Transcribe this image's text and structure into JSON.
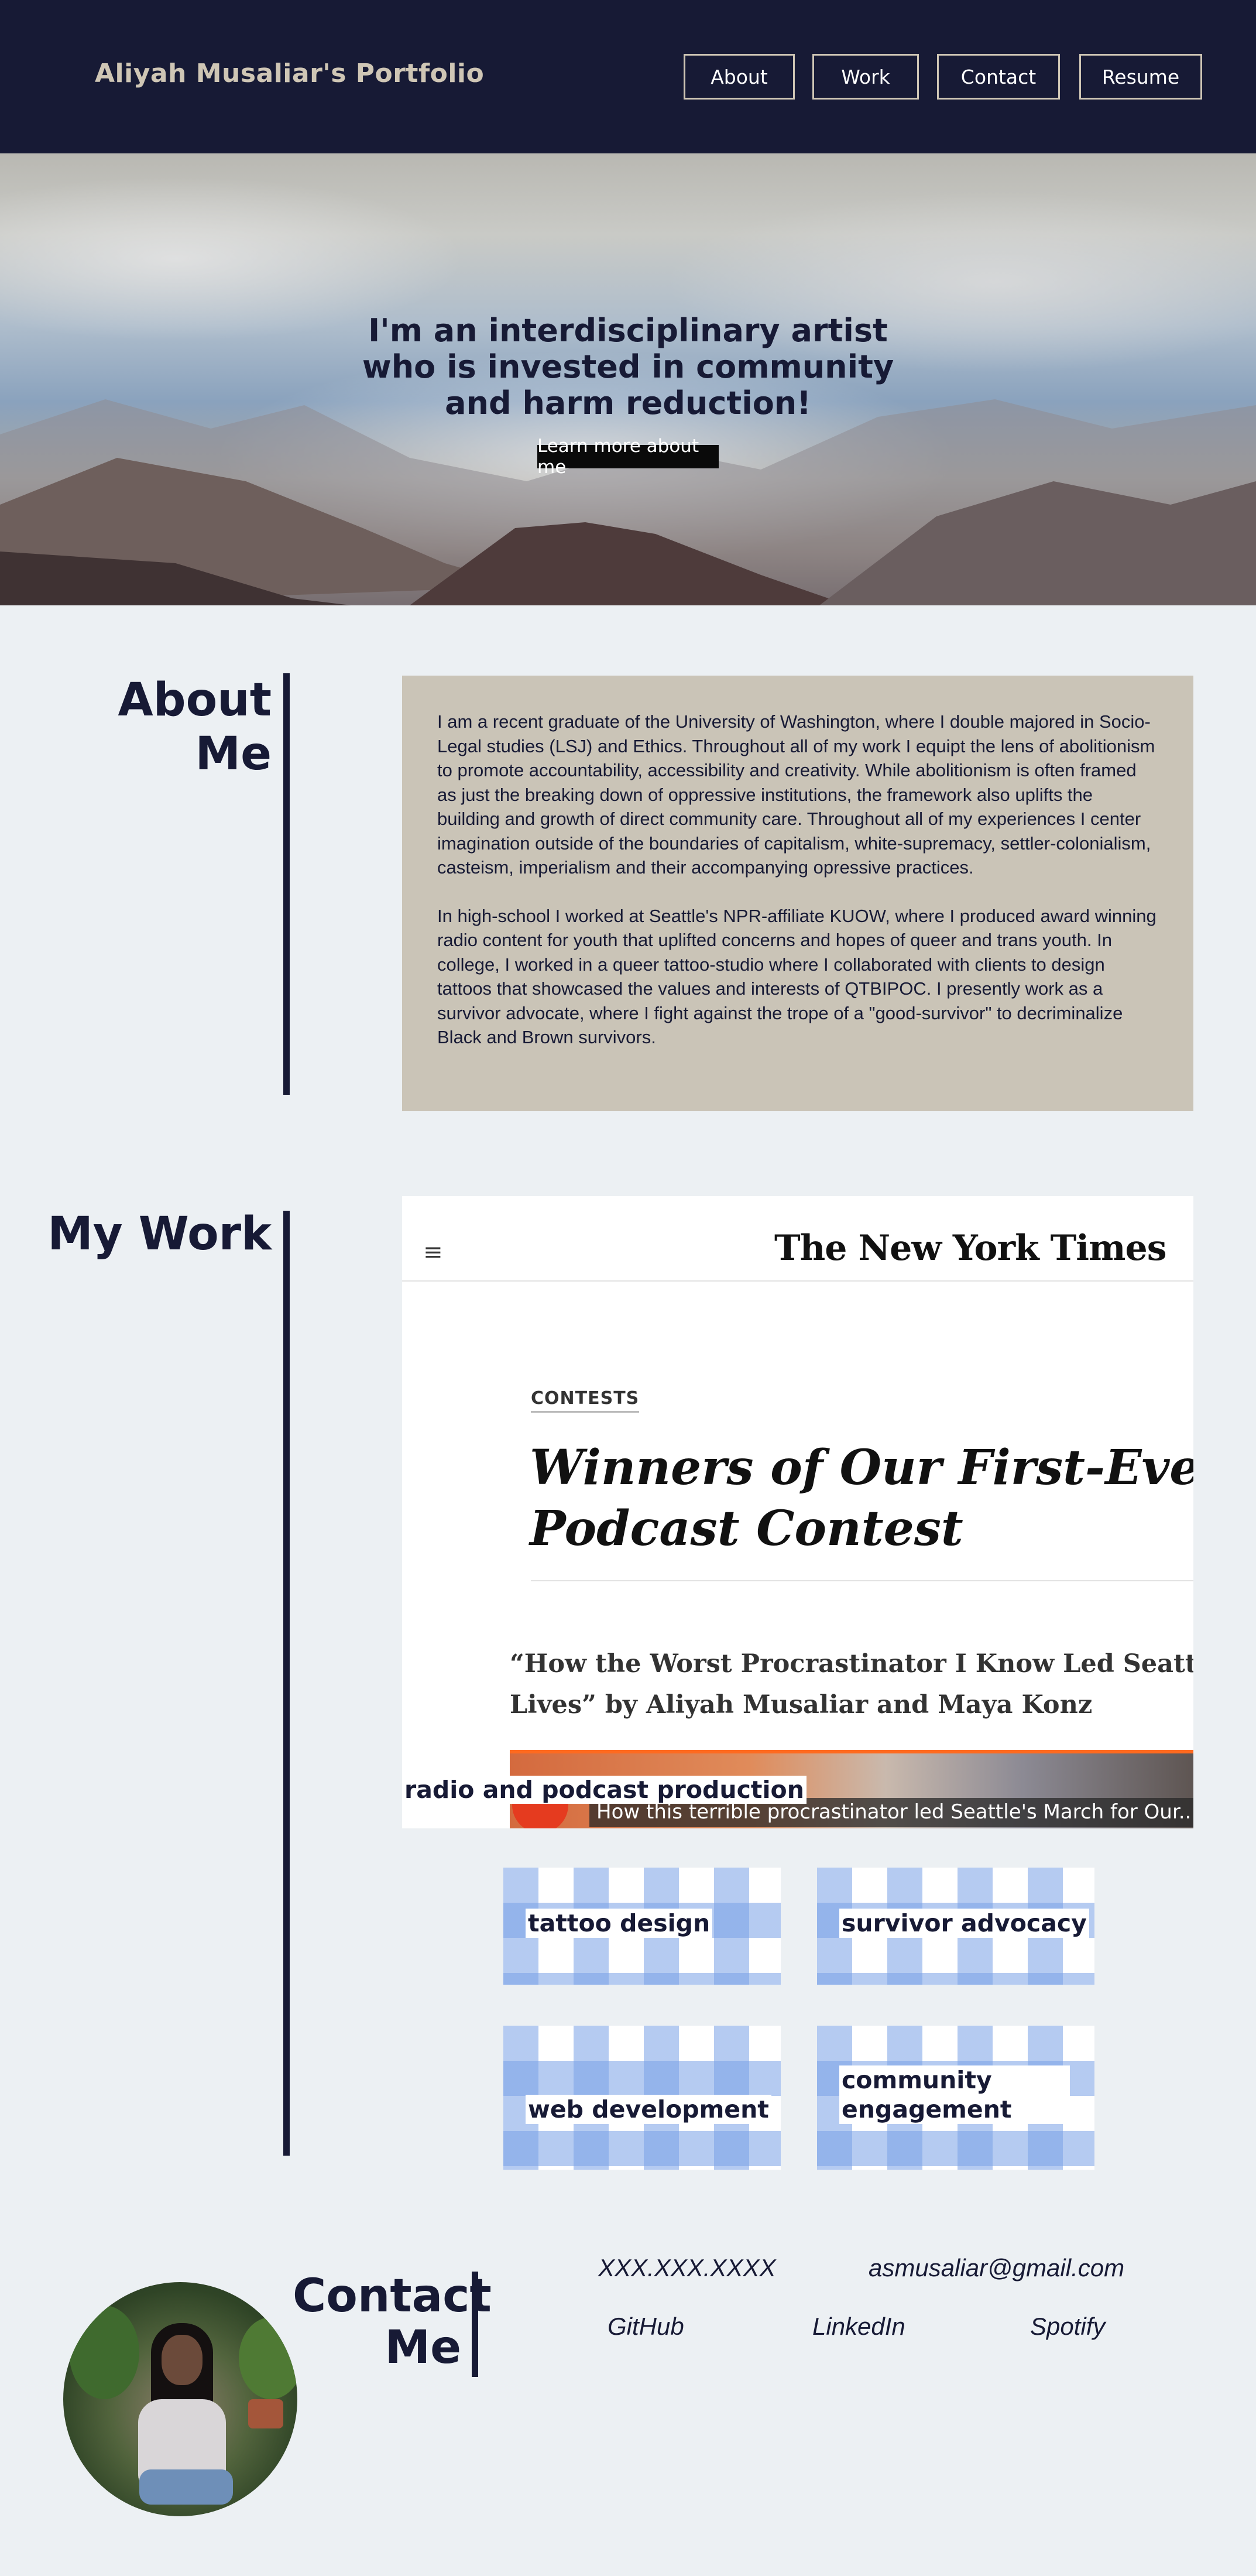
{
  "header": {
    "brand": "Aliyah Musaliar's Portfolio",
    "nav": [
      "About",
      "Work",
      "Contact",
      "Resume"
    ]
  },
  "hero": {
    "title": "I'm an interdisciplinary artist who is invested in community and harm reduction!",
    "cta": "Learn more about me"
  },
  "about": {
    "heading_line1": "About",
    "heading_line2": "Me",
    "paragraphs": [
      "I am a recent graduate of the University of Washington, where I double majored in Socio-Legal studies (LSJ) and Ethics. Throughout all of my work I equipt the lens of abolitionism to promote accountability, accessibility and creativity. While abolitionism is often framed as just the breaking down of oppressive institutions, the framework also uplifts the building and growth of direct community care. Throughout all of my experiences I center imagination outside of the boundaries of capitalism, white-supremacy, settler-colonialism, casteism, imperialism and their accompanying opressive practices.",
      "In high-school I worked at Seattle's NPR-affiliate KUOW, where I produced award winning radio content for youth that uplifted concerns and hopes of queer and trans youth. In college, I worked in a queer tattoo-studio where I collaborated with clients to design tattoos that showcased the values and interests of QTBIPOC. I presently work as a survivor advocate, where I fight against the trope of a \"good-survivor\" to decriminalize Black and Brown survivors."
    ]
  },
  "work": {
    "heading": "My Work",
    "featured": {
      "publication": "The New York Times",
      "kicker": "CONTESTS",
      "headline_line1": "Winners of Our First-Ever Studer",
      "headline_line2": "Podcast Contest",
      "subhead_line1": "“How the Worst Procrastinator I Know Led Seattle’s Marc",
      "subhead_line2": "Lives” by Aliyah Musaliar and Maya Konz",
      "video_caption": "How this terrible procrastinator led Seattle's March for Our...",
      "label": "radio and podcast production"
    },
    "tiles": [
      "tattoo design",
      "survivor advocacy",
      "web development",
      "community engagement"
    ]
  },
  "contact": {
    "heading_line1": "Contact",
    "heading_line2": "Me",
    "phone": "XXX.XXX.XXXX",
    "email": "asmusaliar@gmail.com",
    "links": [
      "GitHub",
      "LinkedIn",
      "Spotify"
    ]
  },
  "colors": {
    "navy": "#171a35",
    "tan": "#cac4b7",
    "page_bg": "#ecf0f3",
    "tile_blue": "#78a0e6"
  }
}
